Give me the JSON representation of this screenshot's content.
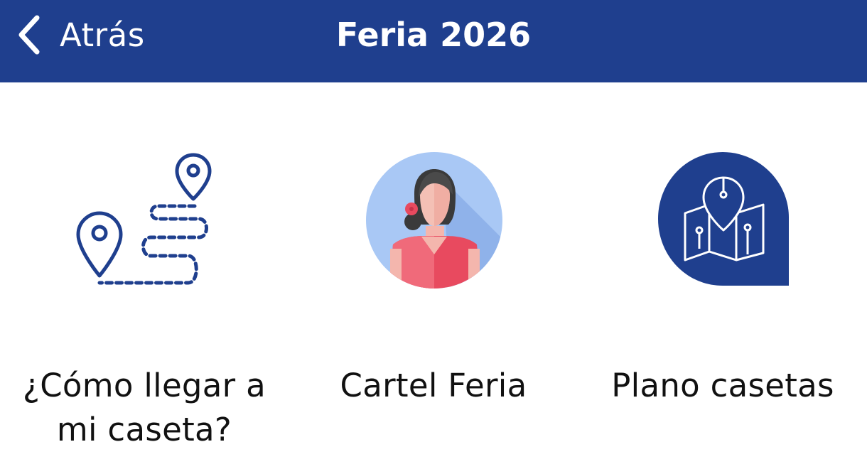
{
  "header": {
    "back_label": "Atrás",
    "title": "Feria 2026"
  },
  "tiles": [
    {
      "label_line1": "¿Cómo llegar a",
      "label_line2": "mi caseta?",
      "icon": "route-map-icon"
    },
    {
      "label_line1": "Cartel Feria",
      "label_line2": "",
      "icon": "flamenca-avatar-icon"
    },
    {
      "label_line1": "Plano casetas",
      "label_line2": "",
      "icon": "map-pin-icon"
    }
  ],
  "colors": {
    "brand_blue": "#1f3f8e",
    "text": "#111111",
    "background": "#ffffff"
  }
}
